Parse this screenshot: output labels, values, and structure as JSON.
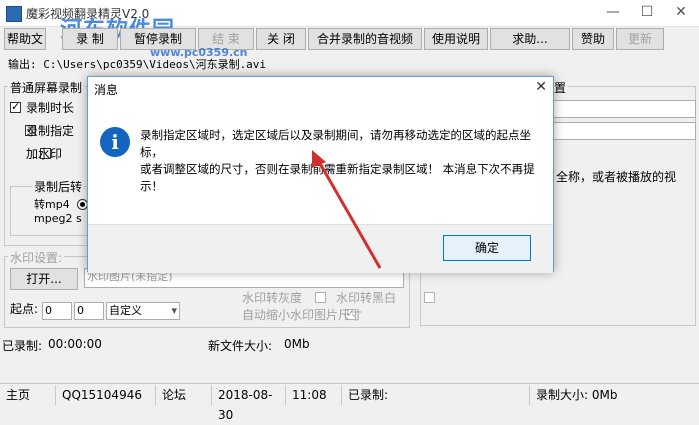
{
  "window": {
    "title": "魔彩视频翻录精灵V2.0",
    "watermark": "河东软件园",
    "watermark_url": "www.pc0359.cn",
    "minimize_glyph": "—",
    "maximize_glyph": "☐",
    "close_glyph": "✕"
  },
  "toolbar": {
    "buttons": [
      {
        "label": "帮助文"
      },
      {
        "label": "录 制"
      },
      {
        "label": "暂停录制"
      },
      {
        "label": "结 束"
      },
      {
        "label": "关 闭"
      },
      {
        "label": "合并录制的音视频"
      },
      {
        "label": "使用说明"
      },
      {
        "label": "求助..."
      },
      {
        "label": "赞助"
      },
      {
        "label": "更新"
      }
    ]
  },
  "output": {
    "path": "输出: C:\\Users\\pc0359\\Videos\\河东录制.avi"
  },
  "left_panel": {
    "group_label": "普通屏幕录制",
    "cb_duration": "录制时长",
    "cb_region": "录制指定",
    "cb_watermark": "加水印",
    "convert_group": "录制后转",
    "radio_mp4": "转mp4",
    "radio_mpeg2": "mpeg2 s"
  },
  "right_panel": {
    "group_label": "置",
    "hint": "全称，或者被播放的视"
  },
  "watermark_settings": {
    "label": "水印设置:",
    "open_button": "打开...",
    "path_placeholder": "水印图片(未指定)",
    "origin_label": "起点:",
    "x_value": "0",
    "y_value": "0",
    "align_value": "自定义",
    "cb_gray": "水印转灰度",
    "cb_bw": "水印转黑白",
    "cb_autoscale": "自动缩小水印图片尺寸"
  },
  "recorded": {
    "label": "已录制:",
    "time": "00:00:00",
    "new_size_label": "新文件大小:",
    "new_size": "0Mb"
  },
  "dialog": {
    "title": "消息",
    "close_glyph": "✕",
    "icon_glyph": "i",
    "message_line1": "录制指定区域时，选定区域后以及录制期间，请勿再移动选定的区域的起点坐标，",
    "message_line2": "或者调整区域的尺寸，否则在录制前需重新指定录制区域！ 本消息下次不再提示！",
    "ok_label": "确定"
  },
  "statusbar": {
    "home": "主页",
    "qq": "QQ15104946",
    "forum": "论坛",
    "date": "2018-08-30",
    "time": "11:08",
    "recorded": "已录制:",
    "size": "录制大小: 0Mb"
  },
  "colors": {
    "accent": "#0078d7",
    "info_icon": "#1565c0",
    "arrow": "#d32f2f",
    "watermark": "#1f6fd6"
  }
}
